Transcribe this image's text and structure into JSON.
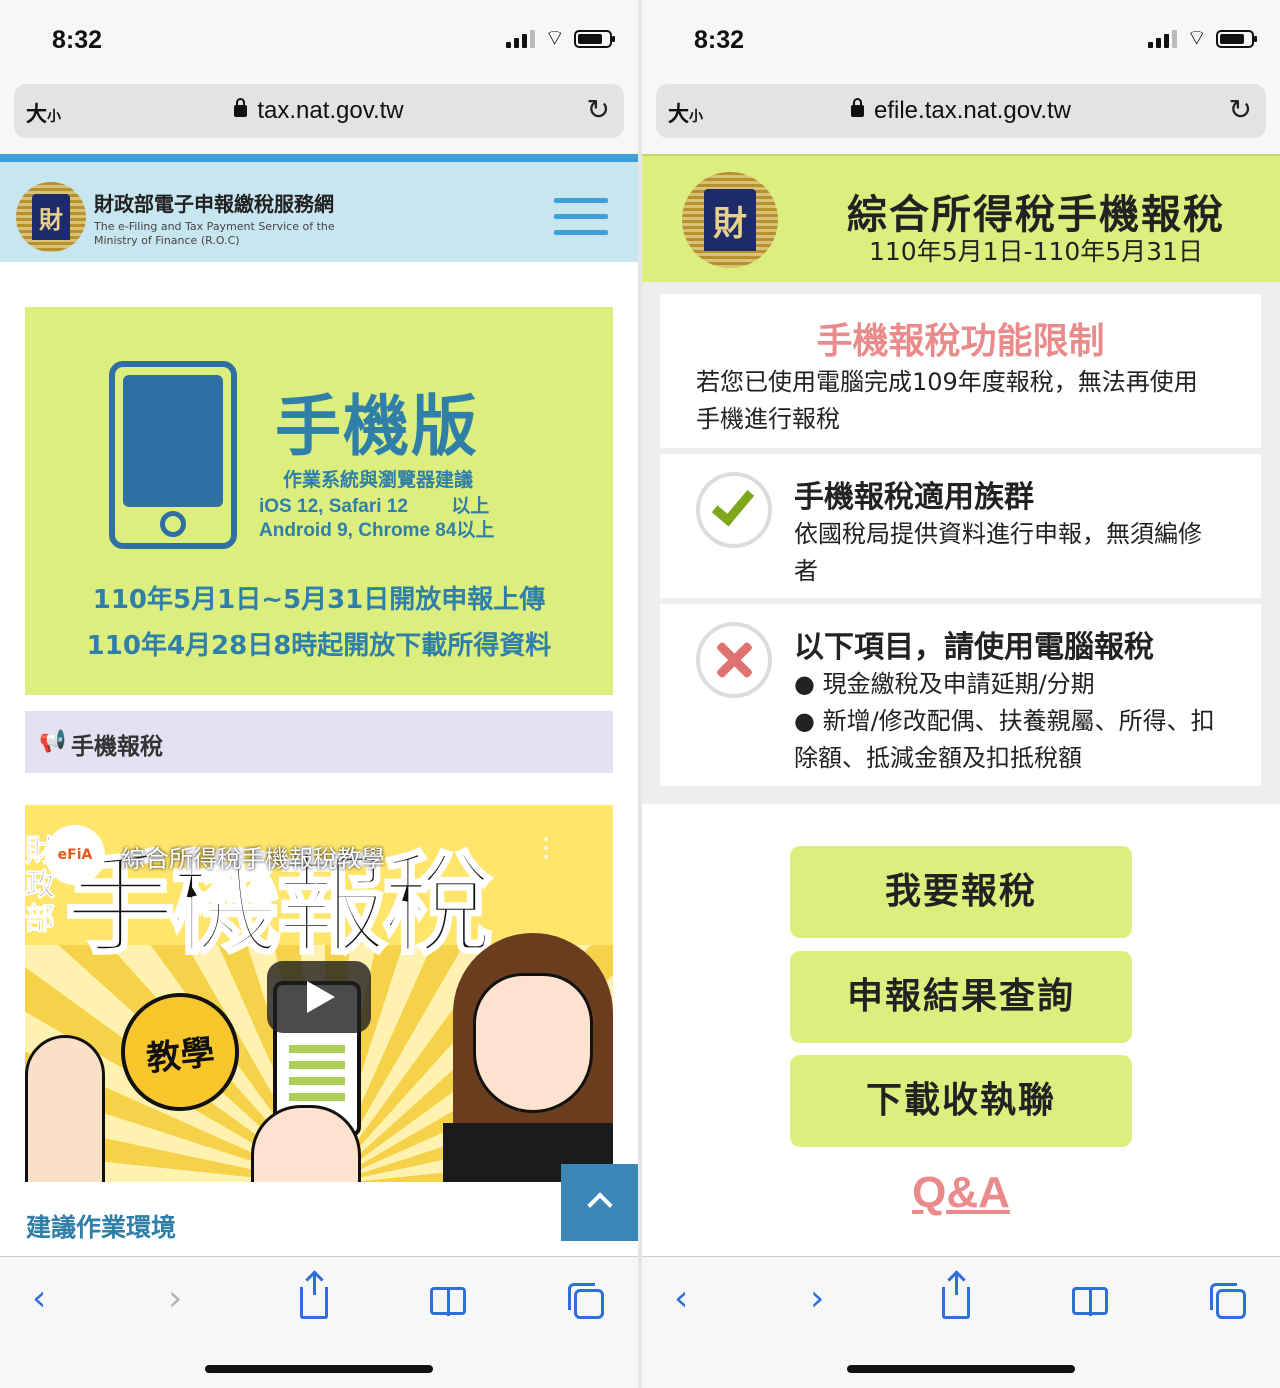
{
  "colors": {
    "accent_blue": "#3ea0d6",
    "lime": "#dcef7e",
    "teal_text": "#2f7fa8",
    "pink": "#e98b8b",
    "safari_blue": "#2f6fdb"
  },
  "left": {
    "status": {
      "time": "8:32"
    },
    "url": {
      "text_size": "大",
      "text_size_small": "小",
      "domain": "tax.nat.gov.tw",
      "reload_icon": "↻"
    },
    "header": {
      "site_name": "財政部電子申報繳稅服務網",
      "site_name_en_1": "The e-Filing and Tax Payment Service of the",
      "site_name_en_2": "Ministry of Finance (R.O.C)",
      "seal_char": "財"
    },
    "banner": {
      "title": "手機版",
      "os_title": "作業系統與瀏覽器建議",
      "os_ios": "iOS 12, Safari 12　　 以上",
      "os_android": "Android 9, Chrome 84以上",
      "date_line1": "110年5月1日~5月31日開放申報上傳",
      "date_line2": "110年4月28日8時起開放下載所得資料"
    },
    "section": {
      "icon": "megaphone-icon",
      "label": "手機報稅"
    },
    "video": {
      "logo_text": "eFiA",
      "caption": "綜合所得稅手機報稅教學",
      "big_text": "手機報稅",
      "side_text": "財政部",
      "badge": "教學"
    },
    "env_heading": "建議作業環境"
  },
  "right": {
    "status": {
      "time": "8:32"
    },
    "url": {
      "text_size": "大",
      "text_size_small": "小",
      "domain": "efile.tax.nat.gov.tw",
      "reload_icon": "↻"
    },
    "header": {
      "seal_char": "財",
      "title": "綜合所得稅手機報稅",
      "dates": "110年5月1日-110年5月31日"
    },
    "limit": {
      "title": "手機報稅功能限制",
      "body": "若您已使用電腦完成109年度報稅，無法再使用手機進行報稅"
    },
    "eligible": {
      "title": "手機報稅適用族群",
      "body": "依國稅局提供資料進行申報，無須編修者"
    },
    "pc_only": {
      "title": "以下項目，請使用電腦報稅",
      "bullets": [
        "● 現金繳稅及申請延期/分期",
        "● 新增/修改配偶、扶養親屬、所得、扣除額、抵減金額及扣抵稅額"
      ]
    },
    "buttons": {
      "file_tax": "我要報稅",
      "query_result": "申報結果查詢",
      "download_receipt": "下載收執聯"
    },
    "qa": "Q&A"
  },
  "toolbar": {
    "back": "‹",
    "forward": "›"
  }
}
